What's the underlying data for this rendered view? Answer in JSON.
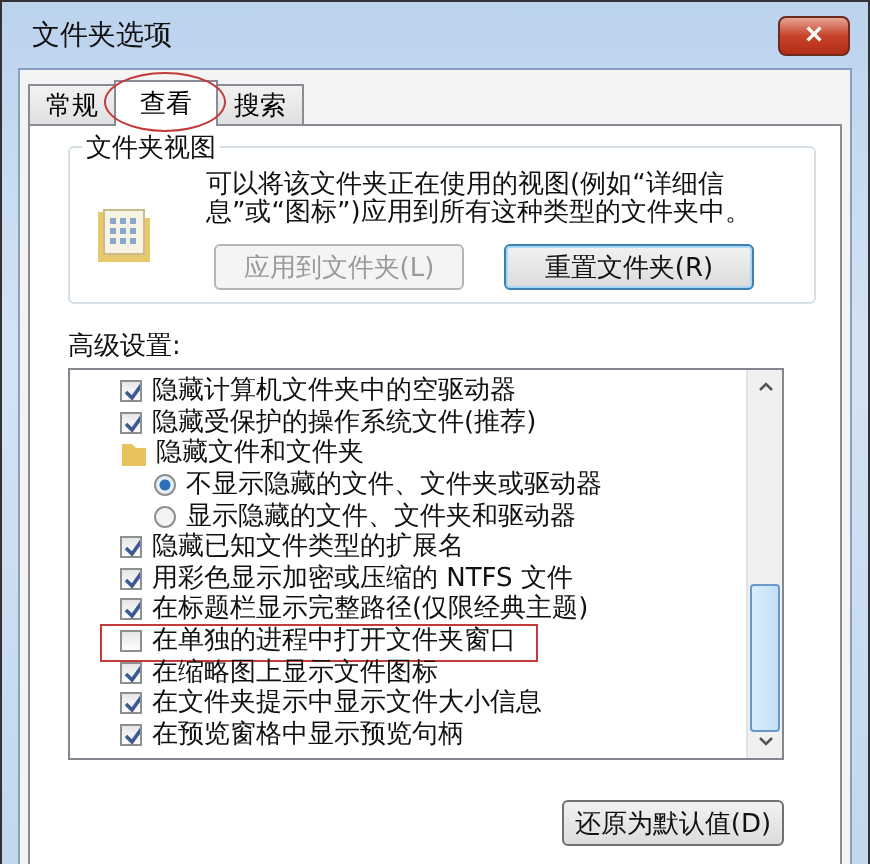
{
  "window": {
    "title": "文件夹选项",
    "close": "×"
  },
  "tabs": [
    {
      "label": "常规",
      "selected": false,
      "highlighted": false
    },
    {
      "label": "查看",
      "selected": true,
      "highlighted": true
    },
    {
      "label": "搜索",
      "selected": false,
      "highlighted": false
    }
  ],
  "folder_views": {
    "title": "文件夹视图",
    "description": "可以将该文件夹正在使用的视图(例如“详细信息”或“图标”)应用到所有这种类型的文件夹中。",
    "buttons": [
      {
        "label": "应用到文件夹(L)",
        "disabled": true,
        "default": false
      },
      {
        "label": "重置文件夹(R)",
        "disabled": false,
        "default": true
      }
    ]
  },
  "advanced": {
    "title": "高级设置:",
    "items": [
      {
        "kind": "checkbox",
        "label": "隐藏计算机文件夹中的空驱动器",
        "checked": true,
        "highlighted": false
      },
      {
        "kind": "checkbox",
        "label": "隐藏受保护的操作系统文件(推荐)",
        "checked": true,
        "highlighted": false
      },
      {
        "kind": "folder",
        "label": "隐藏文件和文件夹",
        "children": [
          {
            "kind": "radio",
            "label": "不显示隐藏的文件、文件夹或驱动器",
            "selected": true
          },
          {
            "kind": "radio",
            "label": "显示隐藏的文件、文件夹和驱动器",
            "selected": false
          }
        ]
      },
      {
        "kind": "checkbox",
        "label": "隐藏已知文件类型的扩展名",
        "checked": true,
        "highlighted": false
      },
      {
        "kind": "checkbox",
        "label": "用彩色显示加密或压缩的 NTFS 文件",
        "checked": true,
        "highlighted": false
      },
      {
        "kind": "checkbox",
        "label": "在标题栏显示完整路径(仅限经典主题)",
        "checked": true,
        "highlighted": false
      },
      {
        "kind": "checkbox",
        "label": "在单独的进程中打开文件夹窗口",
        "checked": false,
        "highlighted": true
      },
      {
        "kind": "checkbox",
        "label": "在缩略图上显示文件图标",
        "checked": true,
        "highlighted": false
      },
      {
        "kind": "checkbox",
        "label": "在文件夹提示中显示文件大小信息",
        "checked": true,
        "highlighted": false
      },
      {
        "kind": "checkbox",
        "label": "在预览窗格中显示预览句柄",
        "checked": true,
        "highlighted": false
      }
    ]
  },
  "restore_button": {
    "label": "还原为默认值(D)"
  }
}
